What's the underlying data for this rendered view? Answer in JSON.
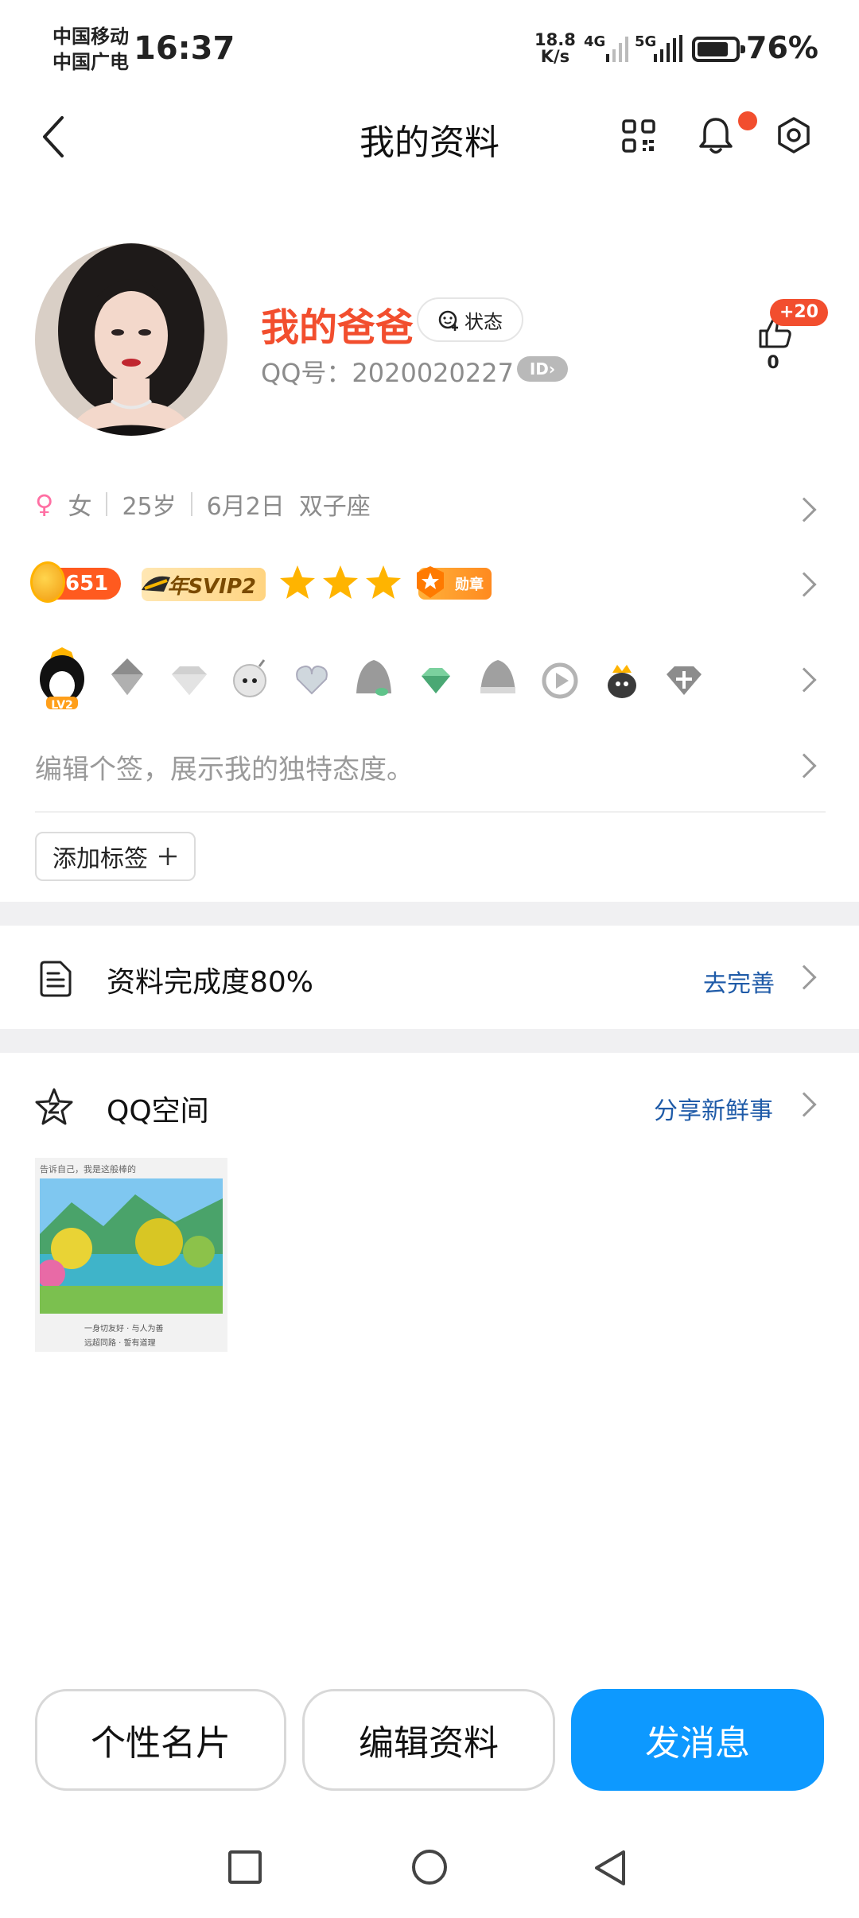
{
  "status_bar": {
    "carrier_1": "中国移动",
    "carrier_2": "中国广电",
    "time": "16:37",
    "net_speed_value": "18.8",
    "net_speed_unit": "K/s",
    "signal_1": "4G",
    "signal_2": "5G",
    "battery": "76%"
  },
  "nav": {
    "title": "我的资料",
    "icons": [
      "back-icon",
      "qr-code-icon",
      "bell-icon",
      "settings-icon"
    ]
  },
  "profile": {
    "nickname": "我的爸爸",
    "status_label": "状态",
    "qq_number": "QQ号：2020020227",
    "id_chip": "ID",
    "likes_badge": "+20",
    "likes_count": "0"
  },
  "info": {
    "gender": "女",
    "age": "25岁",
    "birthday": "6月2日",
    "zodiac": "双子座"
  },
  "badges": {
    "level_value": "651",
    "svip": "年SVIP2",
    "medal": "勋章"
  },
  "icons_row": {
    "level_badge": "LV2"
  },
  "signature_placeholder": "编辑个签，展示我的独特态度。",
  "add_tag_label": "添加标签",
  "completion": {
    "label": "资料完成度80%",
    "link": "去完善"
  },
  "qzone": {
    "title": "QQ空间",
    "link": "分享新鲜事",
    "thumb_caption": "告诉自己，我是这般棒的",
    "thumb_line1": "一身切友好 · 与人为善",
    "thumb_line2": "远超同路 · 誓有道理"
  },
  "buttons": {
    "card": "个性名片",
    "edit": "编辑资料",
    "message": "发消息"
  },
  "colors": {
    "accent_blue": "#0d99ff",
    "nickname_red": "#f24e2e",
    "link_blue": "#1f5ba8"
  }
}
